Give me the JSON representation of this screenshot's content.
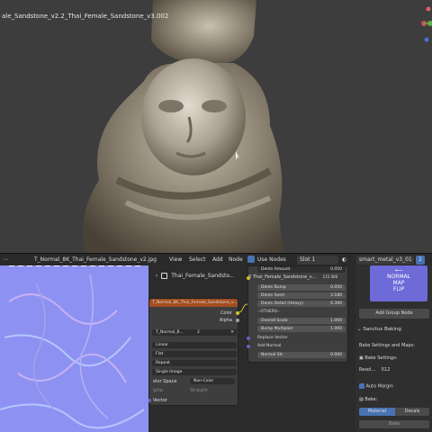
{
  "viewport": {
    "title": "ale_Sandstone_v2.2_Thai_Female_Sandstone_v3.002"
  },
  "header": {
    "image_name": "T_Normal_8K_Thai_Female_Sandstone_v2.jpg",
    "menu": [
      "View",
      "Select",
      "Add",
      "Node"
    ],
    "use_nodes": "Use Nodes",
    "slot": "Slot 1",
    "material": "smart_metal_v3_01",
    "users": "2"
  },
  "image_node": {
    "title": "T_Normal_8K_Thai_Female_Sandstone_v...",
    "out_color": "Color",
    "out_alpha": "Alpha",
    "image": "T_Normal_8...",
    "users": "2",
    "interp": "Linear",
    "proj": "Flat",
    "ext": "Repeat",
    "src": "Single Image",
    "cs_label": "olor Space",
    "cs_value": "Non-Color",
    "alpha_label": "lpha",
    "alpha_value": "Straight",
    "vector": "Vector"
  },
  "node_group": {
    "breadcrumb": "Thai_Female_Sandsto...",
    "group": "Thai_Female_Sandstone_v...",
    "count": "115 000",
    "fields": [
      {
        "label": "Dents Amount",
        "value": "0.050"
      },
      {
        "label": "Dents Bump",
        "value": "0.050"
      },
      {
        "label": "Dents Seed",
        "value": "3.180"
      },
      {
        "label": "Dents Detail (Heavy)",
        "value": "6.300"
      }
    ],
    "others": "--OTHERS--",
    "others_fields": [
      {
        "label": "Overall Scale",
        "value": "1.000"
      },
      {
        "label": "Bump Multiplier",
        "value": "1.000"
      }
    ],
    "replace_vector": "Replace Vector",
    "add_normal": "Add Normal",
    "normal_str": {
      "label": "Normal Str.",
      "value": "0.000"
    }
  },
  "sidebar": {
    "thumb_text": [
      "NORMAL",
      "MAP",
      "FLIP"
    ],
    "add_group_node": "Add Group Node",
    "sanctus_baking": "Sanctus Baking",
    "bake_settings_maps": "Bake Settings and Maps:",
    "bake_settings": "Bake Settings:",
    "resolution_label": "Resol...",
    "resolution_value": "512",
    "auto_margin": "Auto Margin",
    "bake_label": "Bake:",
    "material_tab": "Material",
    "decals_tab": "Decals",
    "bake_button": "Bake"
  },
  "colors": {
    "accent": "#4772b3",
    "node_header": "#a34d1f",
    "thumb": "#6e6ad8",
    "normal_map": "#8d92f2"
  }
}
